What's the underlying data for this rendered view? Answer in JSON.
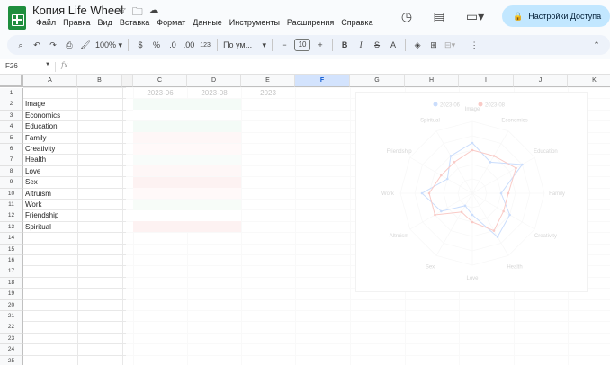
{
  "app": {
    "doc_title": "Копия Life Wheel",
    "menu": [
      "Файл",
      "Правка",
      "Вид",
      "Вставка",
      "Формат",
      "Данные",
      "Инструменты",
      "Расширения",
      "Справка"
    ],
    "share_label": "Настройки Доступа"
  },
  "toolbar": {
    "zoom": "100%",
    "currency": "$",
    "percent": "%",
    "dec_decrease": ".0",
    "dec_increase": ".00",
    "number_format": "123",
    "font": "По ум...",
    "font_size": "10",
    "bold": "B",
    "italic": "I",
    "text_color": "A"
  },
  "formula_bar": {
    "cell_ref": "F26",
    "fx": "fx",
    "value": ""
  },
  "columns": [
    "A",
    "B",
    "C",
    "D",
    "E",
    "F",
    "G",
    "H",
    "I",
    "J",
    "K"
  ],
  "selected_column": "F",
  "rows": [
    "1",
    "2",
    "3",
    "4",
    "5",
    "6",
    "7",
    "8",
    "9",
    "10",
    "11",
    "12",
    "13",
    "14",
    "15",
    "16",
    "17",
    "18",
    "19",
    "20",
    "21",
    "22",
    "23",
    "24",
    "25"
  ],
  "headers": {
    "c1": "2023-06",
    "d1": "2023-08",
    "e1": "2023"
  },
  "labels": [
    "Image",
    "Economics",
    "Education",
    "Family",
    "Creativity",
    "Health",
    "Love",
    "Sex",
    "Altruism",
    "Work",
    "Friendship",
    "Spiritual"
  ],
  "chart_data": {
    "type": "radar",
    "categories": [
      "Image",
      "Economics",
      "Education",
      "Family",
      "Creativity",
      "Health",
      "Love",
      "Sex",
      "Altruism",
      "Work",
      "Friendship",
      "Spiritual"
    ],
    "series": [
      {
        "name": "2023-06",
        "color": "#4285f4",
        "values": [
          7,
          5,
          8,
          4,
          6,
          7,
          3,
          2,
          5,
          7,
          4,
          6
        ]
      },
      {
        "name": "2023-08",
        "color": "#ea4335",
        "values": [
          6,
          6,
          7,
          5,
          5,
          6,
          4,
          3,
          6,
          6,
          5,
          5
        ]
      }
    ],
    "rmax": 10
  }
}
